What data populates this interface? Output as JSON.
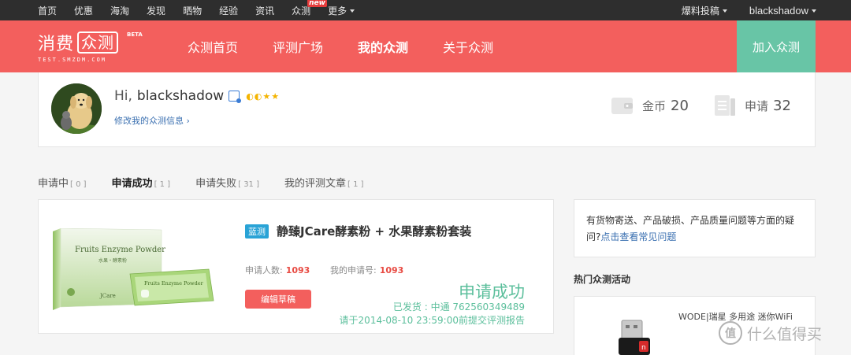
{
  "topbar": {
    "nav": [
      {
        "label": "首页"
      },
      {
        "label": "优惠"
      },
      {
        "label": "海淘"
      },
      {
        "label": "发现"
      },
      {
        "label": "晒物"
      },
      {
        "label": "经验"
      },
      {
        "label": "资讯"
      },
      {
        "label": "众测",
        "badge": "new"
      },
      {
        "label": "更多"
      }
    ],
    "submit_label": "爆料投稿",
    "username": "blackshadow"
  },
  "header": {
    "logo_text": "消费",
    "logo_box_text": "众测",
    "logo_beta": "BETA",
    "logo_sub": "TEST.SMZDM.COM",
    "nav": [
      {
        "label": "众测首页"
      },
      {
        "label": "评测广场"
      },
      {
        "label": "我的众测"
      },
      {
        "label": "关于众测"
      }
    ],
    "join_label": "加入众测"
  },
  "profile": {
    "greeting": "Hi,",
    "name": "blackshadow",
    "level_icons": "◐◐★★",
    "edit_label": "修改我的众测信息",
    "coins_label": "金币",
    "coins_value": "20",
    "apply_label": "申请",
    "apply_value": "32"
  },
  "tabs": [
    {
      "label": "申请中",
      "count": "[ 0 ]"
    },
    {
      "label": "申请成功",
      "count": "[ 1 ]"
    },
    {
      "label": "申请失败",
      "count": "[ 31 ]"
    },
    {
      "label": "我的评测文章",
      "count": "[ 1 ]"
    }
  ],
  "product": {
    "tag": "蓝测",
    "title": "静臻JCare酵素粉 + 水果酵素粉套装",
    "applicants_label": "申请人数:",
    "applicants_value": "1093",
    "my_number_label": "我的申请号:",
    "my_number_value": "1093",
    "edit_draft_label": "编辑草稿",
    "status": "申请成功",
    "shipping": "已发货 : 中通  762560349489",
    "deadline": "请于2014-08-10 23:59:00前提交评测报告",
    "box_text": "Fruits Enzyme Powder",
    "box_sub": "水果・酵素粉",
    "box_brand": "JCare",
    "sachet_text": "Fruits Enzyme Powder"
  },
  "sidebar": {
    "faq_text": "有货物寄送、产品破损、产品质量问题等方面的疑问?",
    "faq_link": "点击查看常见问题",
    "hot_title": "热门众测活动",
    "hot_item_name": "WODE|瑞星 多用途 迷你WiFi"
  },
  "watermark": {
    "logo_text": "值",
    "text": "什么值得买"
  },
  "colors": {
    "brand_red": "#f35f5d",
    "join_green": "#68c5a6",
    "status_green": "#5cbf9c",
    "tag_blue": "#29a3d6",
    "link_blue": "#3a6fb0",
    "topbar_bg": "#2e2e2e"
  }
}
